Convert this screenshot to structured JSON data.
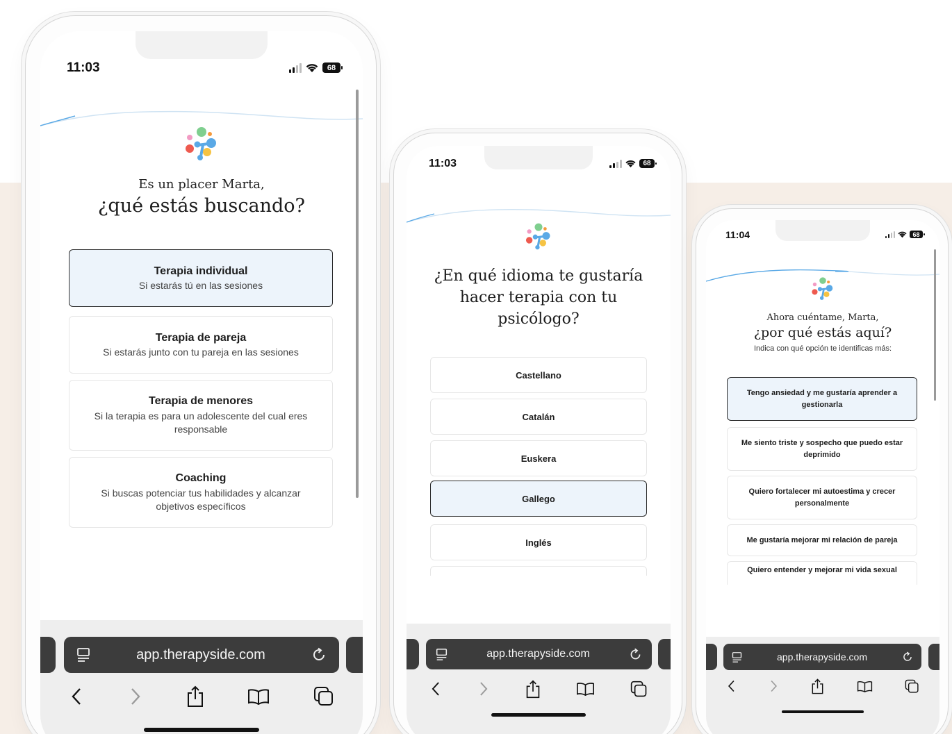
{
  "phones": [
    {
      "status": {
        "time": "11:03",
        "battery": "68"
      },
      "greeting": "Es un placer Marta,",
      "question": "¿qué estás buscando?",
      "options": [
        {
          "title": "Terapia individual",
          "subtitle": "Si estarás tú en las sesiones",
          "selected": true
        },
        {
          "title": "Terapia de pareja",
          "subtitle": "Si estarás junto con tu pareja en las sesiones",
          "selected": false
        },
        {
          "title": "Terapia de menores",
          "subtitle": "Si la terapia es para un adolescente del cual eres responsable",
          "selected": false
        },
        {
          "title": "Coaching",
          "subtitle": "Si buscas potenciar tus habilidades y alcanzar objetivos específicos",
          "selected": false
        }
      ],
      "browser": {
        "url": "app.therapyside.com"
      }
    },
    {
      "status": {
        "time": "11:03",
        "battery": "68"
      },
      "question": "¿En qué idioma te gustaría hacer terapia con tu psicólogo?",
      "options": [
        {
          "title": "Castellano",
          "selected": false
        },
        {
          "title": "Catalán",
          "selected": false
        },
        {
          "title": "Euskera",
          "selected": false
        },
        {
          "title": "Gallego",
          "selected": true
        },
        {
          "title": "Inglés",
          "selected": false
        }
      ],
      "browser": {
        "url": "app.therapyside.com"
      }
    },
    {
      "status": {
        "time": "11:04",
        "battery": "68"
      },
      "greeting": "Ahora cuéntame, Marta,",
      "question": "¿por qué estás aquí?",
      "hint": "Indica con qué opción te identificas más:",
      "options": [
        {
          "title": "Tengo ansiedad y me gustaría aprender a gestionarla",
          "selected": true
        },
        {
          "title": "Me siento triste y sospecho que puedo estar deprimido",
          "selected": false
        },
        {
          "title": "Quiero fortalecer mi autoestima y crecer personalmente",
          "selected": false
        },
        {
          "title": "Me gustaría mejorar mi relación de pareja",
          "selected": false
        },
        {
          "title": "Quiero entender y mejorar mi vida sexual",
          "selected": false
        }
      ],
      "browser": {
        "url": "app.therapyside.com"
      }
    }
  ],
  "icons": {
    "logo": "therapyside-dots-logo",
    "tabs": "tabs-icon",
    "reload": "reload-icon",
    "back": "chevron-left-icon",
    "forward": "chevron-right-icon",
    "share": "share-icon",
    "bookmarks": "book-icon",
    "pages": "pages-icon"
  },
  "colors": {
    "selected_bg": "#edf4fb",
    "page_band": "#f6eee7",
    "logo_green": "#7fcf8f",
    "logo_blue": "#5aa9e6",
    "logo_pink": "#f29bc4",
    "logo_red": "#ee5a4f",
    "logo_yellow": "#f6c343",
    "logo_orange": "#f59a3c"
  }
}
